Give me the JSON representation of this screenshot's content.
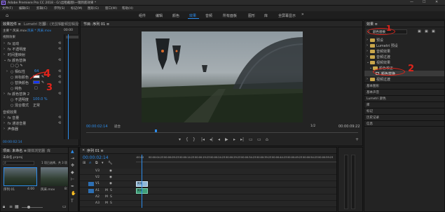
{
  "titlebar": {
    "app_icon_label": "Pr",
    "title": "Adobe Premiere Pro CC 2018 - G:\\出租截图\\一镜到底效果 *",
    "menus": [
      "文件(F)",
      "编辑(E)",
      "剪辑(C)",
      "序列(S)",
      "标记(M)",
      "图形(G)",
      "窗口(W)",
      "帮助(H)"
    ],
    "controls": [
      "—",
      "☐",
      "✕"
    ]
  },
  "workspaces": [
    "组件",
    "编辑",
    "颜色",
    "效果",
    "音频",
    "所有面板",
    "图形",
    "库",
    "全屏幕显示"
  ],
  "workspace_active_index": 3,
  "effect_controls": {
    "tabs": [
      "效果控件 ≡",
      "Lumetri 范围",
      "源：(无剪辑)",
      "音频剪辑混合器"
    ],
    "source_label": "主要 * 风采.mov",
    "clip_label": "风采 * 风采.mov",
    "time_label": "00:00",
    "section_video": "视频效果",
    "rows": [
      {
        "indent": 0,
        "arrow": "›",
        "label": "fx 运动"
      },
      {
        "indent": 0,
        "arrow": "›",
        "label": "fx 不透明度"
      },
      {
        "indent": 0,
        "arrow": "›",
        "label": "时间重映射"
      },
      {
        "indent": 0,
        "arrow": "⌄",
        "label": "fx 颜色替换"
      },
      {
        "indent": 1,
        "arrow": "",
        "label": "□ ◯ ✎"
      },
      {
        "indent": 1,
        "arrow": "›",
        "label": "○ 相似性",
        "value": "64"
      },
      {
        "indent": 1,
        "arrow": "",
        "label": "○ 目标颜色",
        "value": ""
      },
      {
        "indent": 1,
        "arrow": "",
        "label": "○ 替换颜色",
        "value": ""
      },
      {
        "indent": 1,
        "arrow": "",
        "label": "○ 纯色",
        "value": "□"
      },
      {
        "indent": 0,
        "arrow": "›",
        "label": "fx 颜色替换 2"
      },
      {
        "indent": 1,
        "arrow": "",
        "label": "○ 不透明度",
        "value": "100.0 %"
      },
      {
        "indent": 1,
        "arrow": "",
        "label": "○ 混合模式",
        "value": "正常"
      },
      {
        "indent": 0,
        "arrow": "",
        "label": "音频效果"
      },
      {
        "indent": 0,
        "arrow": "›",
        "label": "fx 音量"
      },
      {
        "indent": 0,
        "arrow": "›",
        "label": "fx 通道音量"
      },
      {
        "indent": 0,
        "arrow": "›",
        "label": "声像器"
      }
    ],
    "timecode": "00:00:02:14"
  },
  "project": {
    "tabs": [
      "项目: 未命名 ≡",
      "媒体浏览器",
      "库"
    ],
    "path": "未命名.prproj",
    "search_placeholder": "",
    "item_count": "1 项已选择，共 3 项",
    "thumbs": [
      {
        "name": "序列 01",
        "duration": "4:00"
      },
      {
        "name": "风采.mov",
        "duration": "8:14"
      }
    ]
  },
  "program_monitor": {
    "tab": "节目: 序列 01 ≡",
    "timecode_left": "00:00:02:14",
    "fit": "适合",
    "scale": "1/2",
    "timecode_right": "00:00:09:22",
    "transport": [
      "▾",
      "{",
      "}",
      "|◂",
      "◂|",
      "◂",
      "▶",
      "▸",
      "▸|",
      "▭",
      "▭",
      "⌂",
      "+"
    ]
  },
  "timeline": {
    "tab": "序列 01 ≡",
    "timecode": "00:00:02:14",
    "ruler": [
      ":00:00",
      "00:00:04:23",
      "00:00:09:23",
      "00:00:14:23",
      "00:00:19:23",
      "00:00:24:23",
      "00:00:29:23",
      "00:00:34:23",
      "00:00:39:23",
      "00:00:44:23",
      "00:00:49:23",
      "00:00:54:23",
      "00:00:59:23"
    ],
    "tracks": [
      "V3",
      "V2",
      "V1",
      "A1",
      "A2",
      "A3"
    ],
    "clip_label": "风采",
    "audio_clip_label": "风采"
  },
  "effects_panel": {
    "tab": "效果 ≡",
    "search_value": "颜色替换",
    "tree": [
      {
        "indent": 0,
        "label": "预设"
      },
      {
        "indent": 0,
        "label": "Lumetri 预设"
      },
      {
        "indent": 0,
        "label": "音频效果"
      },
      {
        "indent": 0,
        "label": "音频过渡"
      },
      {
        "indent": 0,
        "label": "视频效果"
      },
      {
        "indent": 1,
        "label": "颜色校正"
      },
      {
        "indent": 2,
        "label": "颜色替换"
      },
      {
        "indent": 0,
        "label": "视频过渡"
      }
    ],
    "sections": [
      "基本图形",
      "基本声音",
      "Lumetri 颜色",
      "库",
      "标记",
      "历史记录",
      "信息"
    ]
  },
  "annotations": {
    "n1": "1",
    "n2": "2",
    "n3": "3",
    "n4": "4"
  },
  "colors": {
    "accent_blue": "#2d8ceb",
    "annotation_red": "#e0241b",
    "clip_video": "#8fb6d6",
    "target_color_swatch": "#1636ff"
  }
}
